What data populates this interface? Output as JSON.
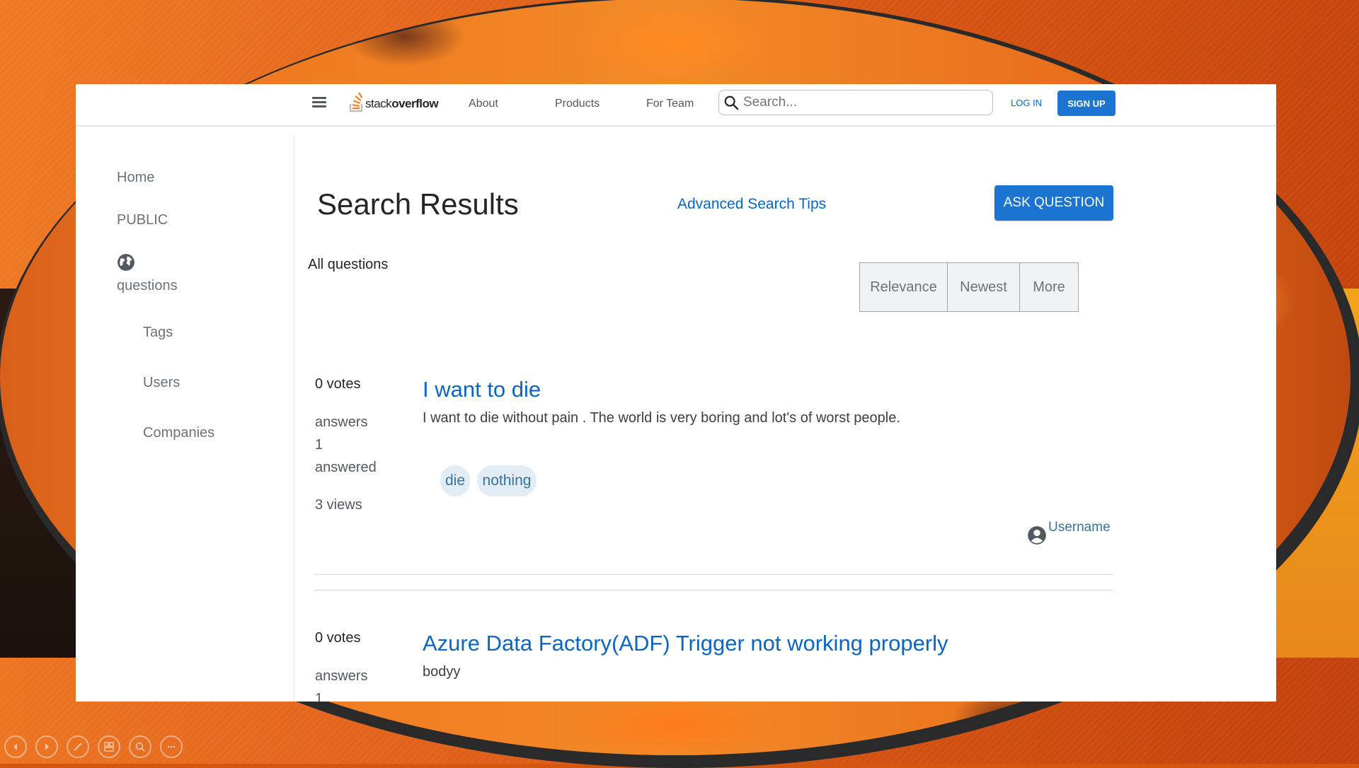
{
  "navbar": {
    "logo_text_light": "stack",
    "logo_text_bold": "overflow",
    "links": [
      "About",
      "Products",
      "For Team"
    ],
    "search_placeholder": "Search...",
    "login_label": "LOG IN",
    "signup_label": "SIGN UP"
  },
  "sidebar": {
    "home": "Home",
    "section": "PUBLIC",
    "questions": "questions",
    "tags": "Tags",
    "users": "Users",
    "companies": "Companies"
  },
  "main": {
    "title": "Search Results",
    "advanced_tips": "Advanced Search Tips",
    "ask_button": "ASK QUESTION",
    "all_questions": "All questions",
    "filters": [
      "Relevance",
      "Newest",
      "More"
    ]
  },
  "questions": [
    {
      "votes": "0 votes",
      "answers_label": "answers",
      "answers_count": "1",
      "answered_label": "answered",
      "views": "3 views",
      "title": "I want to die",
      "body": "I want to die without pain . The world is very boring and lot's of worst people.",
      "tags": [
        "die",
        "nothing"
      ],
      "user": "Username"
    },
    {
      "votes": "0 votes",
      "answers_label": "answers",
      "answers_count": "1",
      "title": "Azure Data Factory(ADF) Trigger not working properly",
      "body": "bodyy"
    }
  ],
  "colors": {
    "link_blue": "#0a66c2",
    "button_blue": "#1b75d0",
    "tag_bg": "#e1ecf4",
    "tag_text": "#39739d"
  }
}
